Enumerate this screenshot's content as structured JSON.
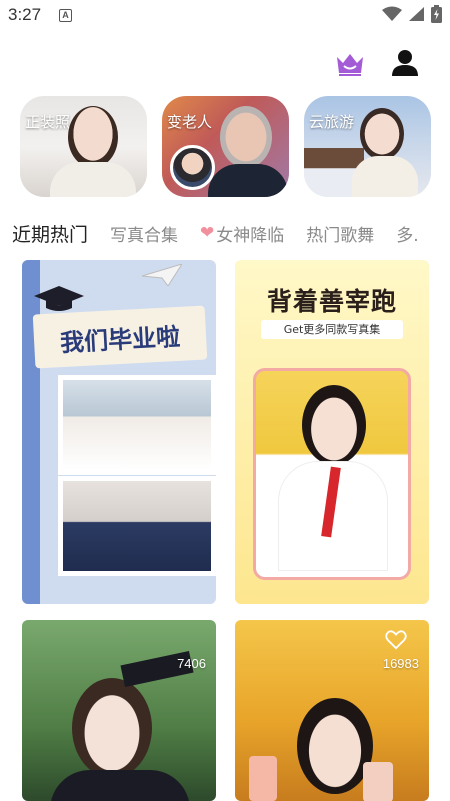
{
  "status_bar": {
    "time": "3:27",
    "notification_badge": "A",
    "icons": [
      "wifi-icon",
      "cellular-signal-icon",
      "battery-charging-icon"
    ]
  },
  "header": {
    "icons": [
      "crown-icon",
      "user-icon"
    ],
    "accent_color": "#a35bd6"
  },
  "features": [
    {
      "label": "正装照"
    },
    {
      "label": "变老人"
    },
    {
      "label": "云旅游"
    }
  ],
  "tabs": [
    {
      "label": "近期热门",
      "active": true
    },
    {
      "label": "写真合集"
    },
    {
      "label": "女神降临",
      "icon": "heart-icon"
    },
    {
      "label": "热门歌舞"
    },
    {
      "label": "多."
    }
  ],
  "tiles": [
    {
      "banner_text": "我们毕业啦"
    },
    {
      "title": "背着善宰跑",
      "subtitle": "Get更多同款写真集"
    },
    {
      "count": "7406"
    },
    {
      "count": "16983"
    }
  ]
}
